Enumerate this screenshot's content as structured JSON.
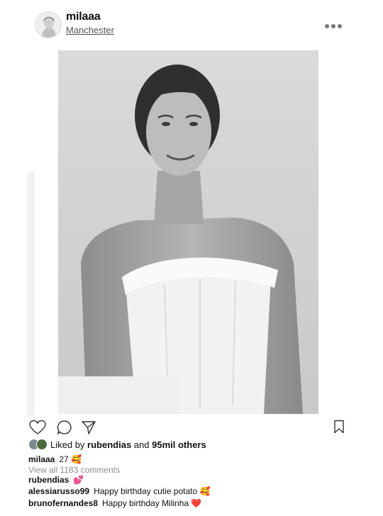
{
  "post": {
    "username": "milaaa",
    "location": "Manchester",
    "likes": {
      "prefix": "Liked by",
      "user": "rubendias",
      "middle": "and",
      "others": "95mil others"
    },
    "caption": {
      "user": "milaaa",
      "text": "27 🥰"
    },
    "view_all": "View all 1183 comments",
    "comments": [
      {
        "user": "rubendias",
        "text": "💕"
      },
      {
        "user": "alessiarusso99",
        "text": "Happy birthday cutie potato 🥰"
      },
      {
        "user": "brunofernandes8",
        "text": "Happy birthday Milinha ❤️"
      }
    ]
  },
  "icons": {
    "more": "more-options-icon",
    "like": "heart-icon",
    "comment": "comment-icon",
    "share": "share-icon",
    "save": "bookmark-icon"
  }
}
